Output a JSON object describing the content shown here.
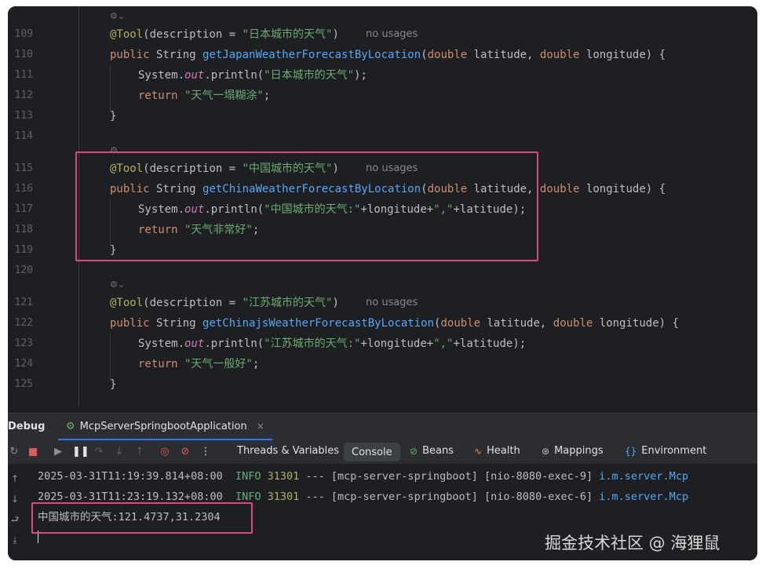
{
  "editor": {
    "lines": [
      {
        "num": "109",
        "hint": "no usages"
      },
      {
        "num": "110"
      },
      {
        "num": "111"
      },
      {
        "num": "112"
      },
      {
        "num": "113"
      },
      {
        "num": "114"
      },
      {
        "num": "115",
        "hint": "no usages"
      },
      {
        "num": "116"
      },
      {
        "num": "117"
      },
      {
        "num": "118"
      },
      {
        "num": "119"
      },
      {
        "num": "120"
      },
      {
        "num": "121",
        "hint": "no usages"
      },
      {
        "num": "122"
      },
      {
        "num": "123"
      },
      {
        "num": "124"
      },
      {
        "num": "125"
      }
    ],
    "code": {
      "l109_ann": "@Tool",
      "l109_a": "(description = ",
      "l109_s": "\"日本城市的天气\"",
      "l109_b": ")",
      "l110_pub": "public",
      "l110_type": " String ",
      "l110_fn": "getJapanWeatherForecastByLocation",
      "l110_p1": "(",
      "l110_d1": "double",
      "l110_p2": " latitude, ",
      "l110_d2": "double",
      "l110_p3": " longitude) {",
      "l111_a": "System.",
      "l111_out": "out",
      "l111_b": ".println(",
      "l111_s": "\"日本城市的天气\"",
      "l111_c": ");",
      "l112_ret": "return",
      "l112_s": " \"天气一塌糊涂\"",
      "l112_c": ";",
      "l113": "}",
      "l115_ann": "@Tool",
      "l115_a": "(description = ",
      "l115_s": "\"中国城市的天气\"",
      "l115_b": ")",
      "l116_pub": "public",
      "l116_type": " String ",
      "l116_fn": "getChinaWeatherForecastByLocation",
      "l116_p1": "(",
      "l116_d1": "double",
      "l116_p2": " latitude, ",
      "l116_d2": "double",
      "l116_p3": " longitude) {",
      "l117_a": "System.",
      "l117_out": "out",
      "l117_b": ".println(",
      "l117_s": "\"中国城市的天气:\"",
      "l117_c": "+longitude+",
      "l117_s2": "\",\"",
      "l117_d": "+latitude);",
      "l118_ret": "return",
      "l118_s": " \"天气非常好\"",
      "l118_c": ";",
      "l119": "}",
      "l121_ann": "@Tool",
      "l121_a": "(description = ",
      "l121_s": "\"江苏城市的天气\"",
      "l121_b": ")",
      "l122_pub": "public",
      "l122_type": " String ",
      "l122_fn": "getChinajsWeatherForecastByLocation",
      "l122_p1": "(",
      "l122_d1": "double",
      "l122_p2": " latitude, ",
      "l122_d2": "double",
      "l122_p3": " longitude) {",
      "l123_a": "System.",
      "l123_out": "out",
      "l123_b": ".println(",
      "l123_s": "\"江苏城市的天气:\"",
      "l123_c": "+longitude+",
      "l123_s2": "\",\"",
      "l123_d": "+latitude);",
      "l124_ret": "return",
      "l124_s": " \"天气一般好\"",
      "l124_c": ";",
      "l125": "}"
    }
  },
  "debug": {
    "title": "Debug",
    "run_tab": "McpServerSpringbootApplication",
    "close": "×"
  },
  "toolbar": {
    "tabs": [
      {
        "label": "Threads & Variables"
      },
      {
        "label": "Console"
      },
      {
        "label": "Beans"
      },
      {
        "label": "Health"
      },
      {
        "label": "Mappings"
      },
      {
        "label": "Environment"
      }
    ]
  },
  "console": {
    "log1": {
      "ts": "2025-03-31T11:19:39.814+08:00",
      "level": "INFO",
      "pid": "31301",
      "rest": " --- [mcp-server-springboot] [nio-8080-exec-9] ",
      "logger": "i.m.server.Mcp"
    },
    "log2": {
      "ts": "2025-03-31T11:23:19.132+08:00",
      "level": "INFO",
      "pid": "31301",
      "rest": " --- [mcp-server-springboot] [nio-8080-exec-6] ",
      "logger": "i.m.server.Mcp"
    },
    "output": "中国城市的天气:121.4737,31.2304"
  },
  "watermark": "掘金技术社区 @ 海狸鼠",
  "colors": {
    "highlight_box": "#e0487c",
    "accent": "#3574f0"
  }
}
